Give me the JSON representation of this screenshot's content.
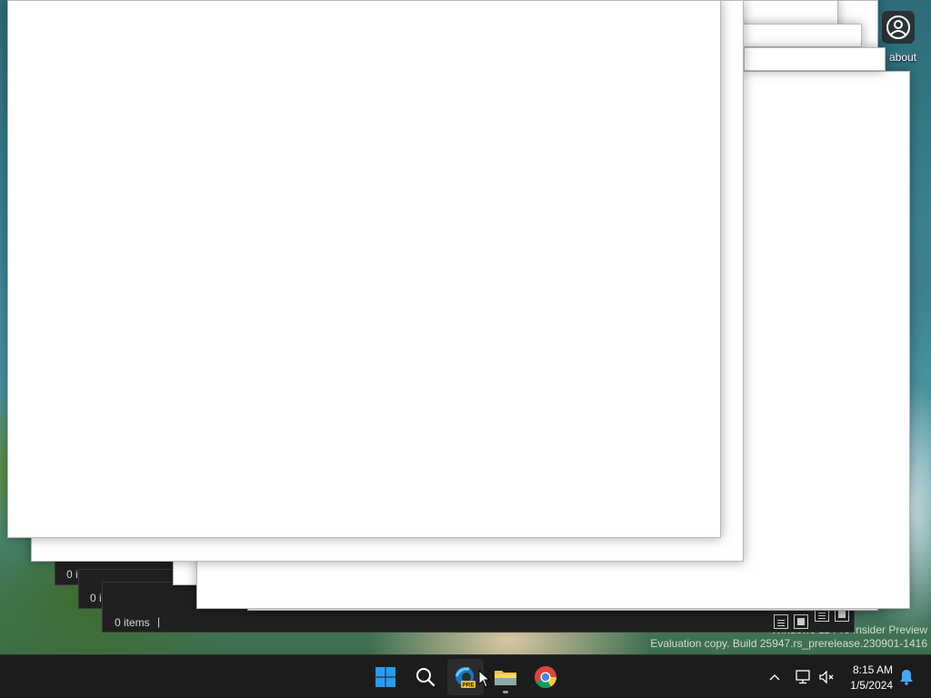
{
  "desktop": {
    "icon_label": "about",
    "icon_name": "about-user-icon"
  },
  "watermark": {
    "line1": "Windows 11 Pro Insider Preview",
    "line2": "Evaluation copy. Build 25947.rs_prerelease.230901-1416"
  },
  "explorer_windows": {
    "status_back_1": "0 i",
    "status_back_2": "0 i",
    "status_front": "0 items",
    "status_separator": "|"
  },
  "taskbar": {
    "apps": [
      {
        "name": "start-button",
        "icon": "windows-logo-icon"
      },
      {
        "name": "search-button",
        "icon": "search-icon"
      },
      {
        "name": "edge-preview-button",
        "icon": "edge-preview-icon",
        "badge": "PRE"
      },
      {
        "name": "file-explorer-button",
        "icon": "folder-icon"
      },
      {
        "name": "chrome-button",
        "icon": "chrome-icon"
      }
    ],
    "clock_time": "8:15 AM",
    "clock_date": "1/5/2024"
  },
  "colors": {
    "taskbar_bg": "#1c1c1c",
    "windows_blue": "#0078d4",
    "window_white": "#ffffff",
    "explorer_dark": "#202020"
  }
}
